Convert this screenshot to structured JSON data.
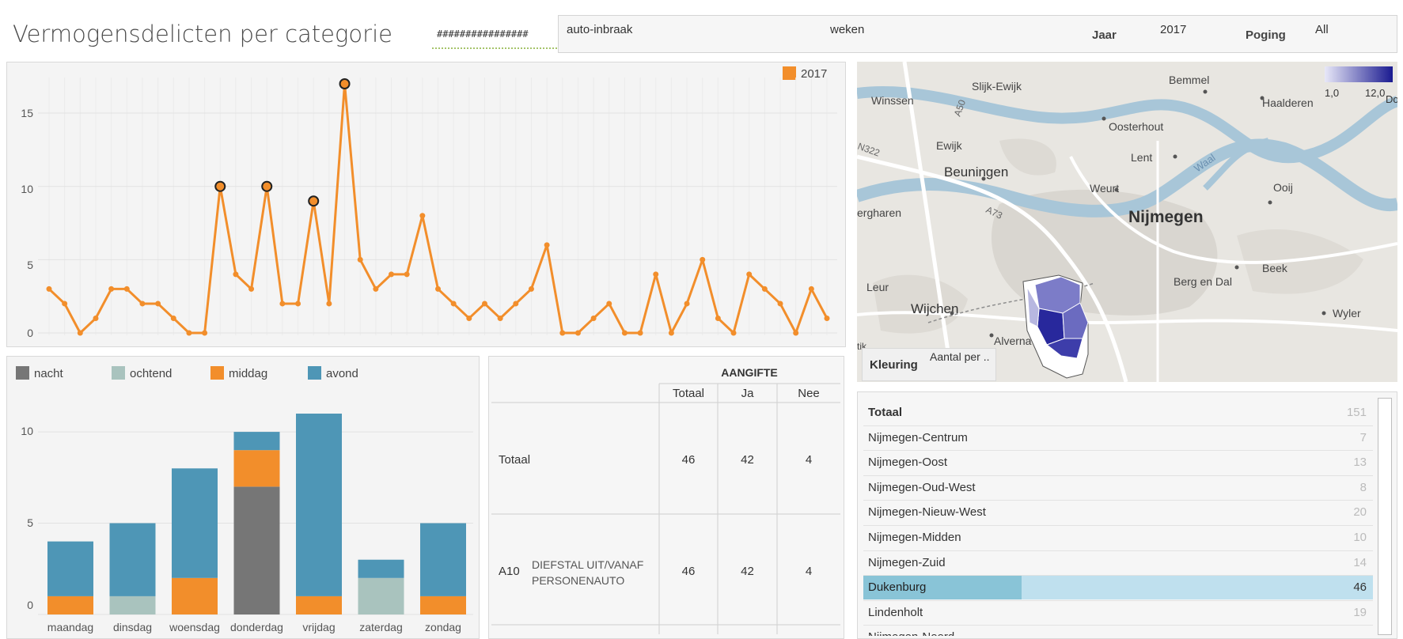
{
  "page": {
    "title": "Vermogensdelicten per categorie"
  },
  "filters": {
    "hash_field": "################",
    "category": "auto-inbraak",
    "period": "weken",
    "year_label": "Jaar",
    "year_value": "2017",
    "attempt_label": "Poging",
    "attempt_value": "All"
  },
  "line_chart": {
    "legend_label": "2017",
    "color": "#f28e2b",
    "y_ticks": [
      "15",
      "10",
      "5",
      "0"
    ]
  },
  "bar_chart": {
    "legend": [
      {
        "label": "nacht",
        "color": "#767676"
      },
      {
        "label": "ochtend",
        "color": "#a9c3be"
      },
      {
        "label": "middag",
        "color": "#f28e2b"
      },
      {
        "label": "avond",
        "color": "#4e96b6"
      }
    ],
    "y_ticks": [
      "10",
      "5",
      "0"
    ]
  },
  "table": {
    "group_header": "AANGIFTE",
    "columns": [
      "Totaal",
      "Ja",
      "Nee"
    ],
    "rows": [
      {
        "code": "",
        "label": "Totaal",
        "values": [
          "46",
          "42",
          "4"
        ]
      },
      {
        "code": "A10",
        "label": "DIEFSTAL UIT/VANAF PERSONENAUTO",
        "values": [
          "46",
          "42",
          "4"
        ]
      }
    ]
  },
  "map": {
    "color_label": "Kleuring",
    "color_value": "Aantal per ..",
    "legend_min": "1,0",
    "legend_max": "12,0",
    "legend_extra": "Do",
    "places": [
      "Winssen",
      "Slijk-Ewijk",
      "Bemmel",
      "Haalderen",
      "Oosterhout",
      "Ewijk",
      "Beuningen",
      "Lent",
      "Weurt",
      "Ooij",
      "Nijmegen",
      "Berg en Dal",
      "Beek",
      "Leur",
      "Wijchen",
      "Alverna",
      "Wyler",
      "ergharen",
      "Waal",
      "A50",
      "A73",
      "N322",
      "tik"
    ]
  },
  "district_list": {
    "rows": [
      {
        "name": "Totaal",
        "value": "151",
        "bold": true
      },
      {
        "name": "Nijmegen-Centrum",
        "value": "7"
      },
      {
        "name": "Nijmegen-Oost",
        "value": "13"
      },
      {
        "name": "Nijmegen-Oud-West",
        "value": "8"
      },
      {
        "name": "Nijmegen-Nieuw-West",
        "value": "20"
      },
      {
        "name": "Nijmegen-Midden",
        "value": "10"
      },
      {
        "name": "Nijmegen-Zuid",
        "value": "14"
      },
      {
        "name": "Dukenburg",
        "value": "46",
        "selected": true
      },
      {
        "name": "Lindenholt",
        "value": "19"
      },
      {
        "name": "Nijmegen-Noord",
        "value": ""
      }
    ]
  },
  "chart_data": [
    {
      "type": "line",
      "series": [
        {
          "name": "2017",
          "values": [
            3,
            2,
            0,
            1,
            3,
            3,
            2,
            2,
            1,
            0,
            0,
            10,
            4,
            3,
            10,
            2,
            2,
            9,
            2,
            17,
            5,
            3,
            4,
            4,
            8,
            3,
            2,
            1,
            2,
            1,
            2,
            3,
            6,
            0,
            0,
            1,
            2,
            0,
            0,
            4,
            0,
            2,
            5,
            1,
            0,
            4,
            3,
            2,
            0,
            3,
            1
          ],
          "highlighted_points": [
            11,
            14,
            17,
            19
          ]
        }
      ],
      "ylim": [
        0,
        17
      ],
      "y_ticks": [
        0,
        5,
        10,
        15
      ],
      "legend": "top-right",
      "grid": true
    },
    {
      "type": "bar",
      "stacked": true,
      "categories": [
        "maandag",
        "dinsdag",
        "woensdag",
        "donderdag",
        "vrijdag",
        "zaterdag",
        "zondag"
      ],
      "series": [
        {
          "name": "nacht",
          "values": [
            0,
            0,
            0,
            7,
            0,
            0,
            0
          ]
        },
        {
          "name": "ochtend",
          "values": [
            0,
            1,
            0,
            0,
            0,
            2,
            0
          ]
        },
        {
          "name": "middag",
          "values": [
            1,
            0,
            2,
            2,
            1,
            0,
            1
          ]
        },
        {
          "name": "avond",
          "values": [
            3,
            4,
            6,
            1,
            10,
            1,
            4
          ]
        }
      ],
      "ylim": [
        0,
        11
      ],
      "y_ticks": [
        0,
        5,
        10
      ],
      "legend": "top"
    }
  ]
}
